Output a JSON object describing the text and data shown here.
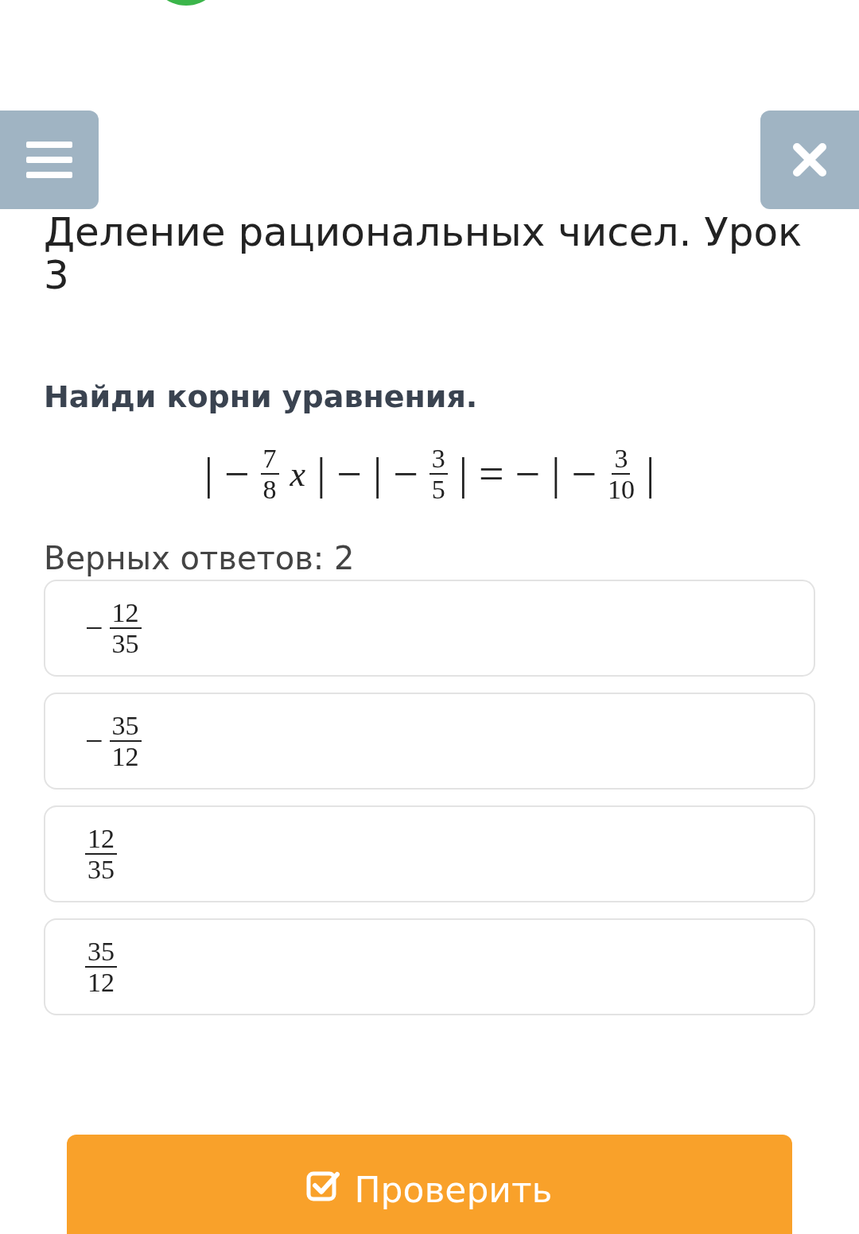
{
  "header": {
    "title": "Деление рациональных чисел. Урок 3"
  },
  "task": {
    "prompt": "Найди корни уравнения.",
    "equation": [
      {
        "kind": "sym",
        "text": "|"
      },
      {
        "kind": "sym",
        "text": "−"
      },
      {
        "kind": "frac",
        "num": "7",
        "den": "8"
      },
      {
        "kind": "var",
        "text": "x"
      },
      {
        "kind": "sym",
        "text": "|"
      },
      {
        "kind": "sym",
        "text": "−"
      },
      {
        "kind": "sym",
        "text": "|"
      },
      {
        "kind": "sym",
        "text": "−"
      },
      {
        "kind": "frac",
        "num": "3",
        "den": "5"
      },
      {
        "kind": "sym",
        "text": "|"
      },
      {
        "kind": "sym",
        "text": "="
      },
      {
        "kind": "sym",
        "text": "−"
      },
      {
        "kind": "sym",
        "text": "|"
      },
      {
        "kind": "sym",
        "text": "−"
      },
      {
        "kind": "frac",
        "num": "3",
        "den": "10"
      },
      {
        "kind": "sym",
        "text": "|"
      }
    ],
    "answers_count": "Верных ответов: 2"
  },
  "options": [
    {
      "sign": "−",
      "num": "12",
      "den": "35",
      "selected": false
    },
    {
      "sign": "−",
      "num": "35",
      "den": "12",
      "selected": false
    },
    {
      "num": "12",
      "den": "35",
      "selected": false
    },
    {
      "num": "35",
      "den": "12",
      "selected": false
    }
  ],
  "check_button": {
    "label": "Проверить"
  }
}
